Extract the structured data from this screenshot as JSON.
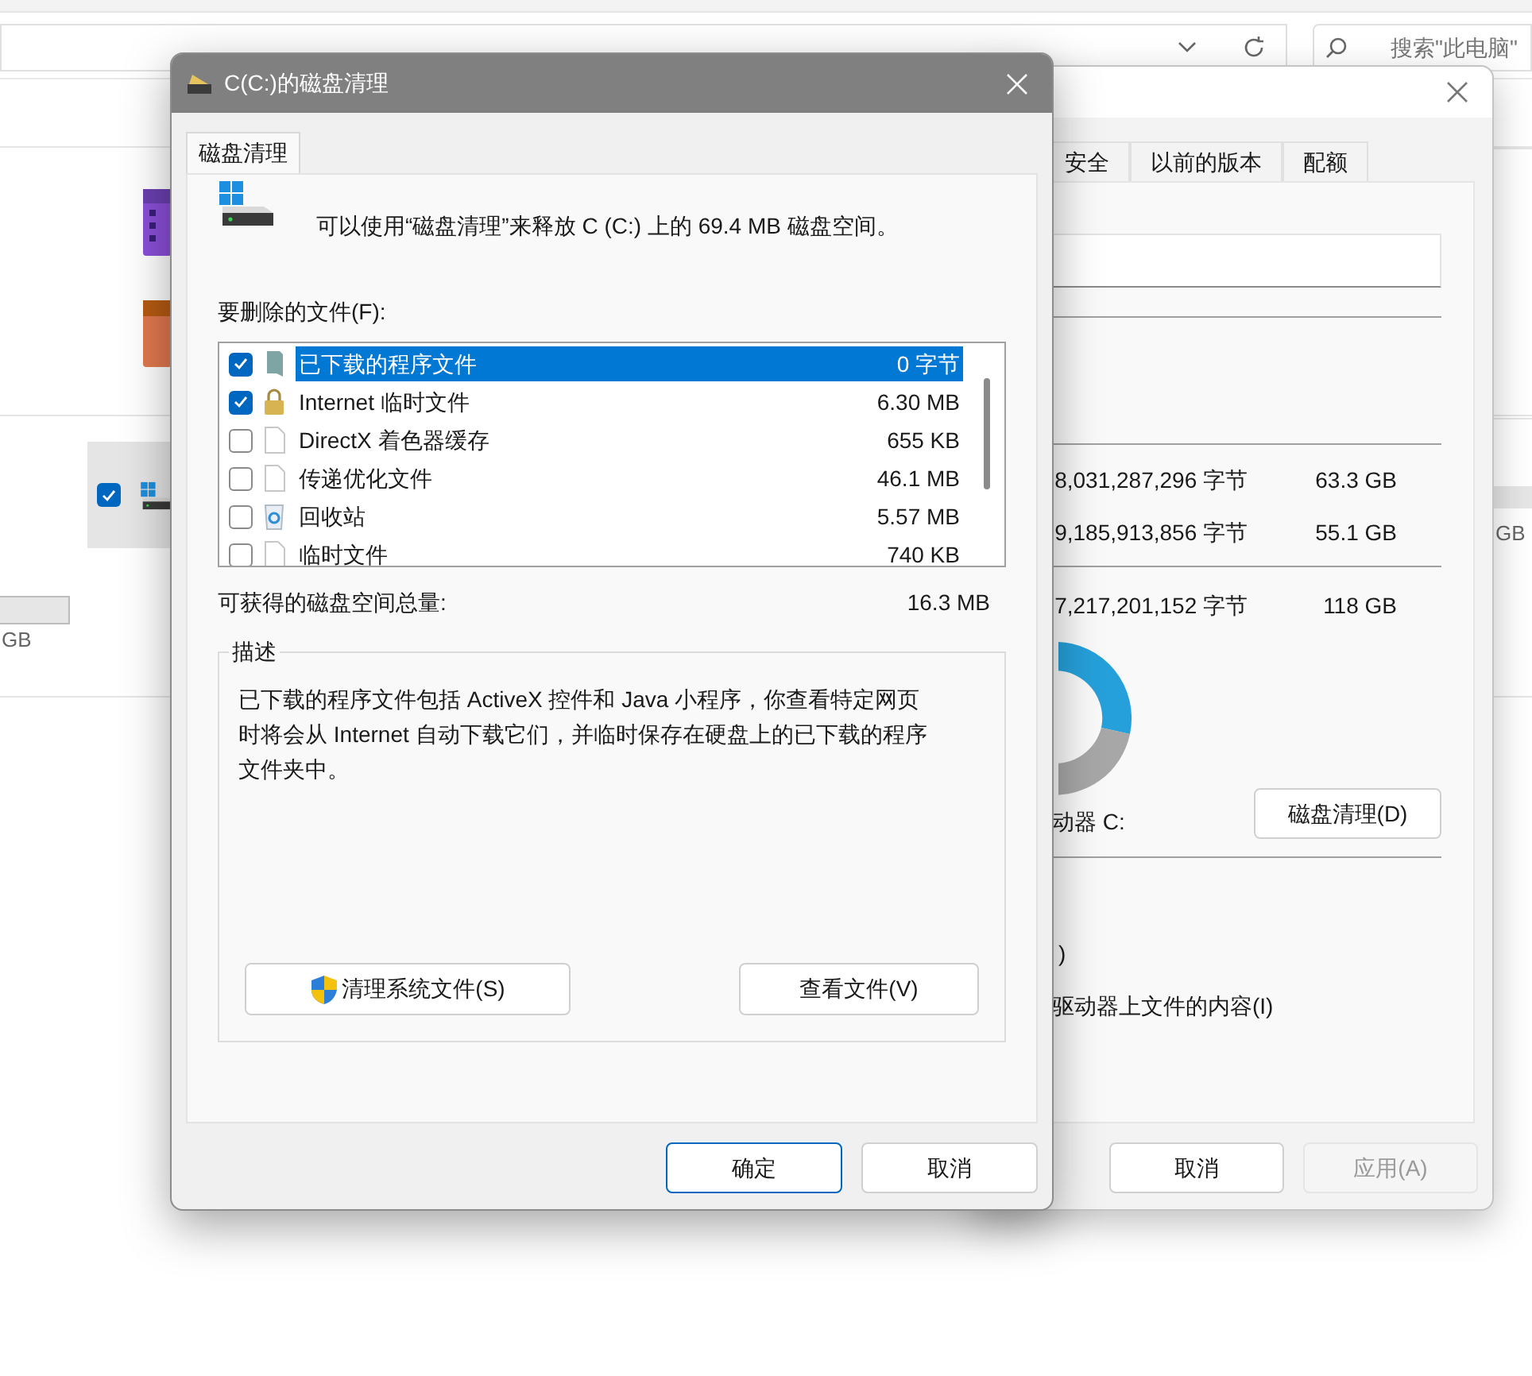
{
  "explorer": {
    "search": {
      "placeholder": "搜索\"此电脑\""
    },
    "drive_tile": {
      "checked": true
    },
    "left_size": "GB",
    "right_size": "GB"
  },
  "properties": {
    "tabs": [
      {
        "label": "安全",
        "selected": false
      },
      {
        "label": "以前的版本",
        "selected": false
      },
      {
        "label": "配额",
        "selected": false
      }
    ],
    "rows": [
      {
        "bytes": "8,031,287,296 字节",
        "size": "63.3 GB"
      },
      {
        "bytes": "9,185,913,856 字节",
        "size": "55.1 GB"
      },
      {
        "bytes": "7,217,201,152 字节",
        "size": "118 GB"
      }
    ],
    "drive_label": "动器 C:",
    "cleanup_button": "磁盘清理(D)",
    "option_fragment": ")",
    "option_label": "驱动器上文件的内容(I)",
    "buttons": [
      {
        "label": "取消",
        "disabled": false
      },
      {
        "label": "应用(A)",
        "disabled": true
      }
    ]
  },
  "dialog": {
    "title": "C(C:)的磁盘清理",
    "tabs": [
      {
        "label": "磁盘清理",
        "selected": true
      }
    ],
    "intro": "可以使用“磁盘清理”来释放 C (C:) 上的 69.4 MB 磁盘空间。",
    "list_label": "要删除的文件(F):",
    "files": [
      {
        "kind": "folder",
        "name": "已下载的程序文件",
        "size": "0 字节",
        "checked": true,
        "selected": true
      },
      {
        "kind": "lock",
        "name": "Internet 临时文件",
        "size": "6.30 MB",
        "checked": true,
        "selected": false
      },
      {
        "kind": "file",
        "name": "DirectX 着色器缓存",
        "size": "655 KB",
        "checked": false,
        "selected": false
      },
      {
        "kind": "file",
        "name": "传递优化文件",
        "size": "46.1 MB",
        "checked": false,
        "selected": false
      },
      {
        "kind": "recycle",
        "name": "回收站",
        "size": "5.57 MB",
        "checked": false,
        "selected": false
      },
      {
        "kind": "file",
        "name": "临时文件",
        "size": "740 KB",
        "checked": false,
        "selected": false
      }
    ],
    "total_label": "可获得的磁盘空间总量:",
    "total_value": "16.3 MB",
    "description_title": "描述",
    "description": "已下载的程序文件包括 ActiveX 控件和 Java 小程序，你查看特定网页时将会从 Internet 自动下载它们，并临时保存在硬盘上的已下载的程序文件夹中。",
    "action_buttons": [
      {
        "kind": "shield",
        "label": "清理系统文件(S)"
      },
      {
        "kind": "plain",
        "label": "查看文件(V)"
      }
    ],
    "buttons": [
      {
        "label": "确定",
        "default": true
      },
      {
        "label": "取消",
        "default": false
      }
    ]
  }
}
